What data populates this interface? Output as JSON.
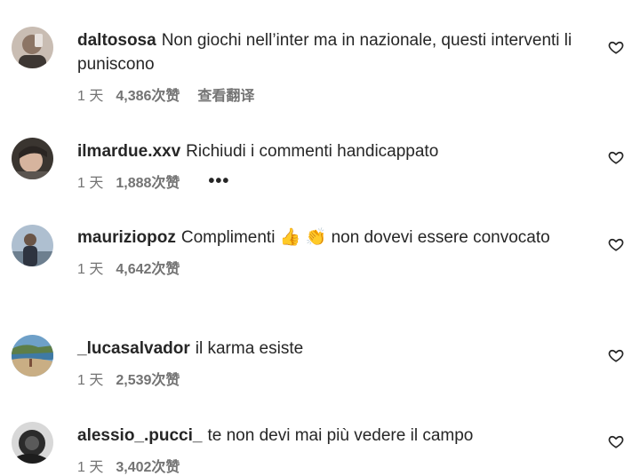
{
  "comments": [
    {
      "username": "daltososa",
      "text": "Non giochi nell’inter ma in nazionale, questi interventi li puniscono",
      "time": "1 天",
      "likes": "4,386次赞",
      "extra": "查看翻译"
    },
    {
      "username": "ilmardue.xxv",
      "text": "Richiudi i commenti handicappato",
      "time": "1 天",
      "likes": "1,888次赞",
      "extra": "•••"
    },
    {
      "username": "mauriziopoz",
      "text": "Complimenti 👍 👏 non dovevi essere convocato",
      "time": "1 天",
      "likes": "4,642次赞"
    },
    {
      "username": "_lucasalvador",
      "text": "il karma esiste",
      "time": "1 天",
      "likes": "2,539次赞"
    },
    {
      "username": "alessio_.pucci_",
      "text": "te non devi mai più vedere il campo",
      "time": "1 天",
      "likes": "3,402次赞"
    }
  ]
}
